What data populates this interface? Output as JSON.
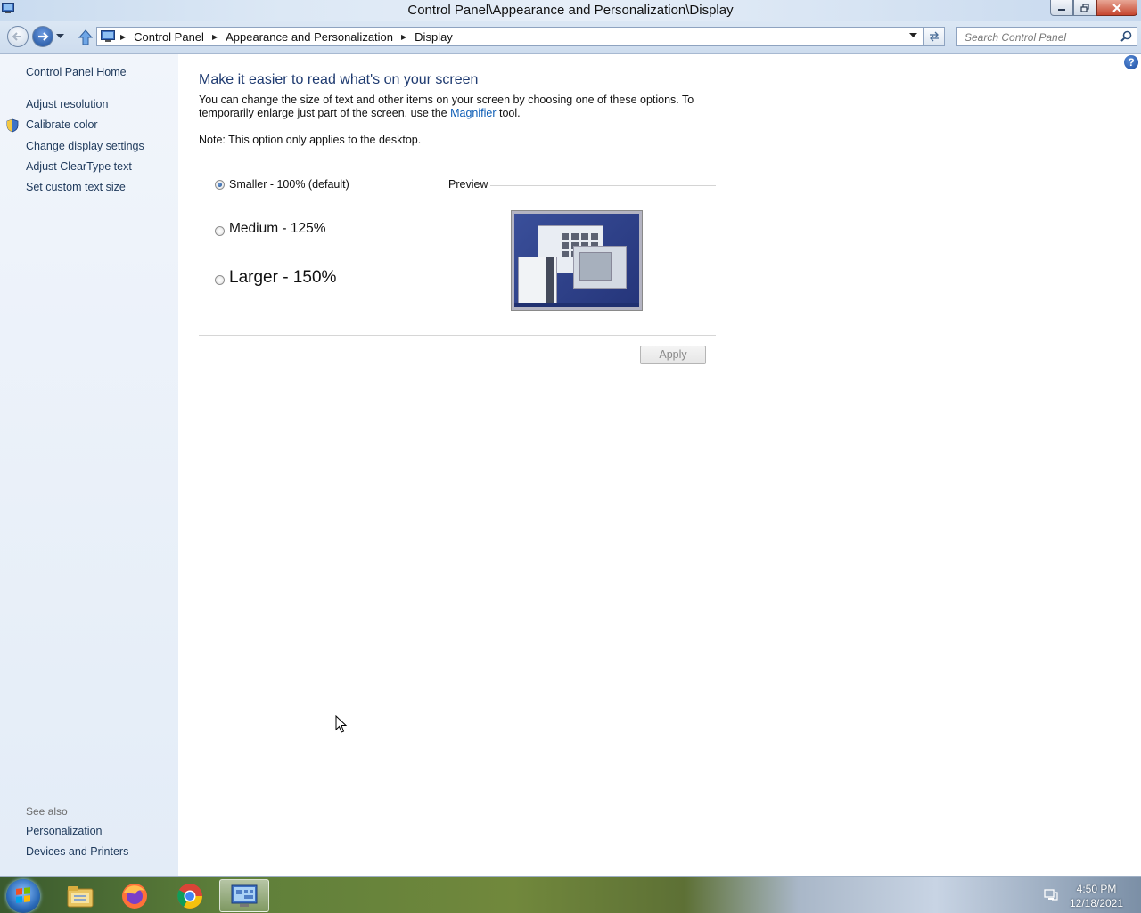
{
  "window": {
    "title": "Control Panel\\Appearance and Personalization\\Display"
  },
  "address_bar": {
    "crumbs": [
      "Control Panel",
      "Appearance and Personalization",
      "Display"
    ]
  },
  "search": {
    "placeholder": "Search Control Panel"
  },
  "left_nav": {
    "home": "Control Panel Home",
    "links": [
      "Adjust resolution",
      "Calibrate color",
      "Change display settings",
      "Adjust ClearType text",
      "Set custom text size"
    ],
    "see_also_label": "See also",
    "see_also": [
      "Personalization",
      "Devices and Printers"
    ]
  },
  "main": {
    "heading": "Make it easier to read what's on your screen",
    "description_before": "You can change the size of text and other items on your screen by choosing one of these options. To temporarily enlarge just part of the screen, use the ",
    "magnifier_link": "Magnifier",
    "description_after": " tool.",
    "note": "Note: This option only applies to the desktop.",
    "options": [
      {
        "label": "Smaller - 100% (default)",
        "selected": true
      },
      {
        "label": "Medium - 125%",
        "selected": false
      },
      {
        "label": "Larger - 150%",
        "selected": false
      }
    ],
    "preview_label": "Preview",
    "apply_label": "Apply"
  },
  "taskbar": {
    "time": "4:50 PM",
    "date": "12/18/2021",
    "pinned": [
      "file-explorer-icon",
      "firefox-icon",
      "chrome-icon",
      "control-panel-icon"
    ]
  },
  "colors": {
    "link": "#1e395b",
    "heading": "#1e3a70",
    "hyperlink": "#0b5cb5"
  }
}
